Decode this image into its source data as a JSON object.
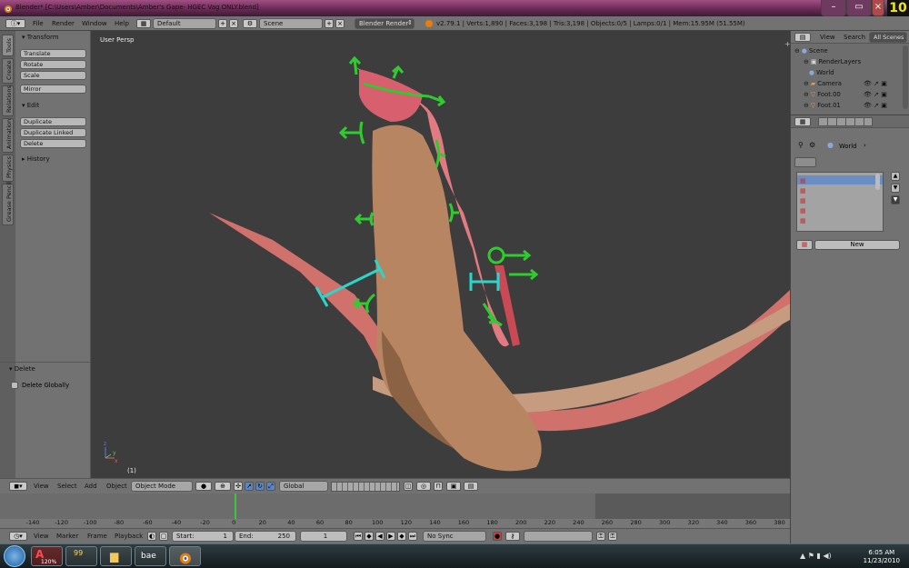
{
  "window": {
    "title": "Blender* [C:\\Users\\Amber\\Documents\\Amber's Gape- HGEC Vag ONLY.blend]",
    "corner_badge": "10"
  },
  "info_header": {
    "menus": [
      "File",
      "Render",
      "Window",
      "Help"
    ],
    "layout": "Default",
    "scene": "Scene",
    "engine": "Blender Render",
    "stats": "v2.79.1 | Verts:1,890 | Faces:3,198 | Tris:3,198 | Objects:0/5 | Lamps:0/1 | Mem:15.95M (51.55M)"
  },
  "tool_shelf": {
    "tabs": [
      "Tools",
      "Create",
      "Relations",
      "Animation",
      "Physics",
      "Grease Pencil"
    ],
    "transform": {
      "title": "Transform",
      "buttons": [
        "Translate",
        "Rotate",
        "Scale",
        "Mirror"
      ]
    },
    "edit": {
      "title": "Edit",
      "buttons": [
        "Duplicate",
        "Duplicate Linked",
        "Delete"
      ]
    },
    "history": {
      "title": "History"
    },
    "operator": {
      "title": "Delete",
      "option": "Delete Globally"
    }
  },
  "viewport": {
    "view_label": "User Persp",
    "frame_label": "(1)",
    "axes": {
      "x": "x",
      "y": "y",
      "z": "z"
    }
  },
  "view3d_header": {
    "menus": [
      "View",
      "Select",
      "Add",
      "Object"
    ],
    "mode": "Object Mode",
    "orientation": "Global"
  },
  "timeline": {
    "ticks": [
      "-140",
      "-120",
      "-100",
      "-80",
      "-60",
      "-40",
      "-20",
      "0",
      "20",
      "40",
      "60",
      "80",
      "100",
      "120",
      "140",
      "160",
      "180",
      "200",
      "220",
      "240",
      "260",
      "280",
      "300",
      "320",
      "340",
      "360",
      "380"
    ],
    "current_frame": 0,
    "menus": [
      "View",
      "Marker",
      "Frame",
      "Playback"
    ],
    "start": {
      "label": "Start:",
      "value": "1"
    },
    "end": {
      "label": "End:",
      "value": "250"
    },
    "frame_value": "1",
    "sync": "No Sync"
  },
  "outliner": {
    "tabs": [
      "View",
      "Search",
      "All Scenes"
    ],
    "items": [
      {
        "name": "Scene",
        "level": 0
      },
      {
        "name": "RenderLayers",
        "level": 1
      },
      {
        "name": "World",
        "level": 1
      },
      {
        "name": "Camera",
        "level": 1
      },
      {
        "name": "Foot.00",
        "level": 1
      },
      {
        "name": "Foot.01",
        "level": 1
      }
    ]
  },
  "properties": {
    "breadcrumb": "World",
    "new_button": "New"
  },
  "taskbar": {
    "clock_time": "6:05 AM",
    "clock_date": "11/23/2010",
    "app_labels": [
      "120%",
      "99",
      "bae"
    ]
  },
  "colors": {
    "widget_green": "#2ecc2e",
    "widget_cyan": "#29d6c9",
    "mesh_pink": "#e07f86",
    "mesh_skin": "#b98863"
  }
}
